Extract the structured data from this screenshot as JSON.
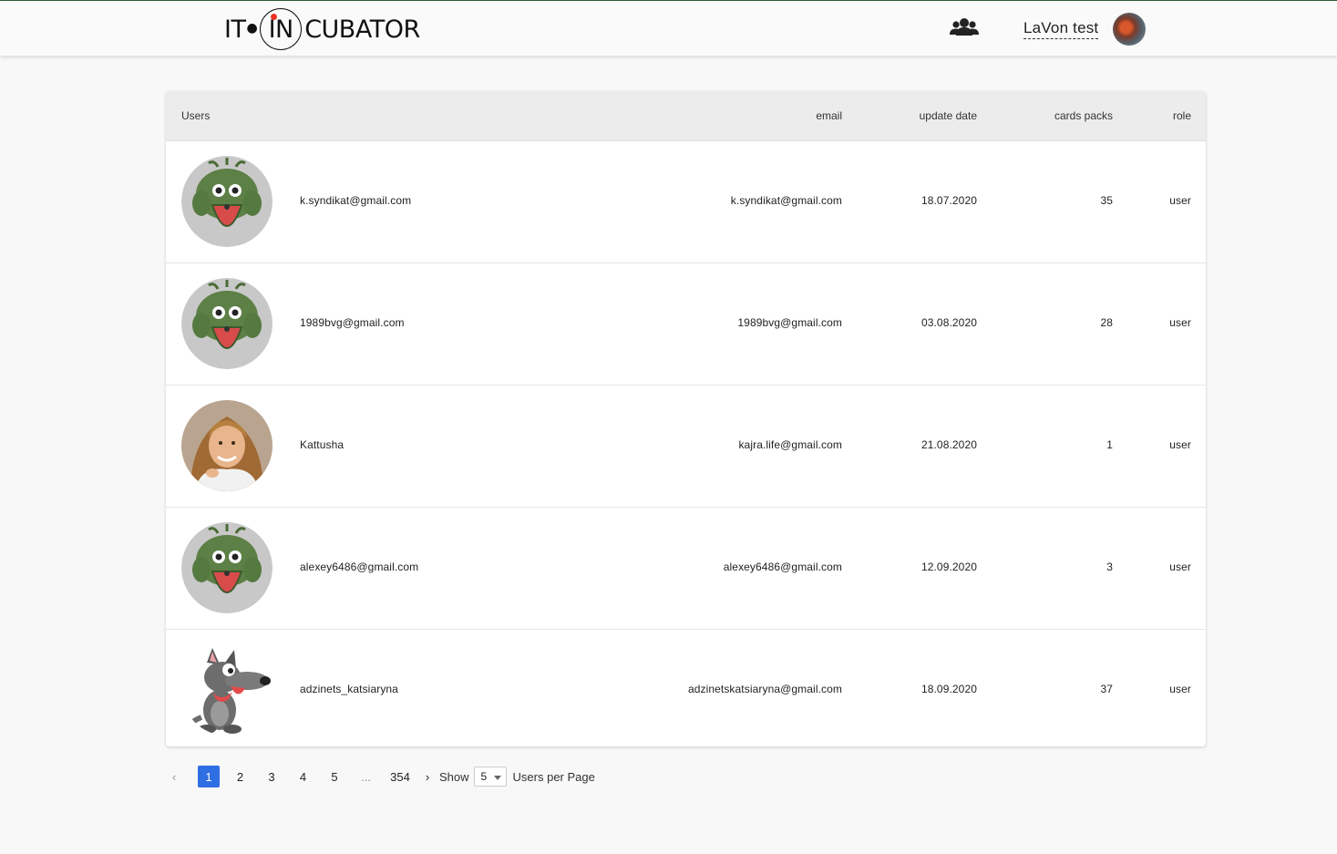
{
  "header": {
    "logo": {
      "prefix": "IT",
      "circle": "IN",
      "suffix": "CUBATOR"
    },
    "users_icon": "users-group-icon",
    "username": "LaVon test"
  },
  "table": {
    "columns": {
      "users": "Users",
      "email": "email",
      "update_date": "update date",
      "cards_packs": "cards packs",
      "role": "role"
    },
    "rows": [
      {
        "name": "k.syndikat@gmail.com",
        "email": "k.syndikat@gmail.com",
        "update_date": "18.07.2020",
        "cards_packs": "35",
        "role": "user",
        "avatar": "frog-avatar"
      },
      {
        "name": "1989bvg@gmail.com",
        "email": "1989bvg@gmail.com",
        "update_date": "03.08.2020",
        "cards_packs": "28",
        "role": "user",
        "avatar": "frog-avatar"
      },
      {
        "name": "Kattusha",
        "email": "kajra.life@gmail.com",
        "update_date": "21.08.2020",
        "cards_packs": "1",
        "role": "user",
        "avatar": "photo-avatar"
      },
      {
        "name": "alexey6486@gmail.com",
        "email": "alexey6486@gmail.com",
        "update_date": "12.09.2020",
        "cards_packs": "3",
        "role": "user",
        "avatar": "frog-avatar"
      },
      {
        "name": "adzinets_katsiaryna",
        "email": "adzinetskatsiaryna@gmail.com",
        "update_date": "18.09.2020",
        "cards_packs": "37",
        "role": "user",
        "avatar": "dog-avatar"
      }
    ]
  },
  "pagination": {
    "prev": "‹",
    "pages": [
      "1",
      "2",
      "3",
      "4",
      "5"
    ],
    "ellipsis": "...",
    "last": "354",
    "next": "›",
    "current": "1",
    "show_label": "Show",
    "per_page_value": "5",
    "per_page_label": "Users per Page"
  },
  "colors": {
    "accent": "#2f6fe4",
    "header_border": "#2e5b2e",
    "table_head": "#ececec"
  }
}
